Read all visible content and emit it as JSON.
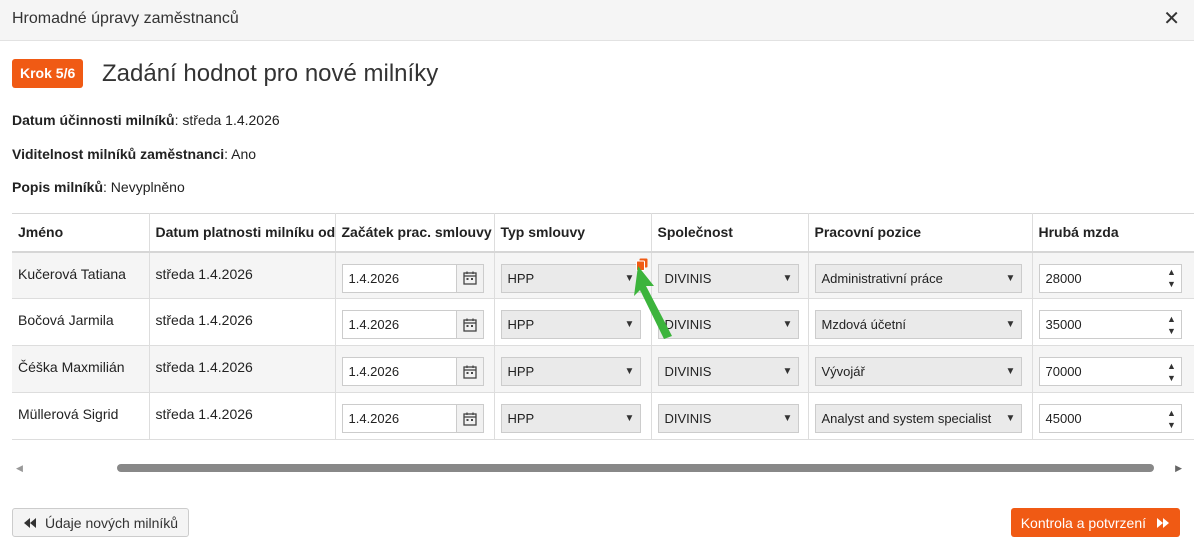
{
  "dialog": {
    "title": "Hromadné úpravy zaměstnanců",
    "close_symbol": "✕"
  },
  "step": {
    "badge": "Krok  5/6",
    "heading": "Zadání hodnot pro nové milníky"
  },
  "info": [
    {
      "label": "Datum účinnosti milníků",
      "value": ": středa 1.4.2026"
    },
    {
      "label": "Viditelnost milníků zaměstnanci",
      "value": ": Ano"
    },
    {
      "label": "Popis milníků",
      "value": ": Nevyplněno"
    }
  ],
  "table": {
    "columns": [
      "Jméno",
      "Datum platnosti milníku od",
      "Začátek prac. smlouvy",
      "Typ smlouvy",
      "Společnost",
      "Pracovní pozice",
      "Hrubá mzda"
    ],
    "rows": [
      {
        "name": "Kučerová Tatiana",
        "valid_from": "středa 1.4.2026",
        "start": "1.4.2026",
        "contract": "HPP",
        "company": "DIVINIS",
        "position": "Administrativní práce",
        "salary": "28000"
      },
      {
        "name": "Bočová Jarmila",
        "valid_from": "středa 1.4.2026",
        "start": "1.4.2026",
        "contract": "HPP",
        "company": "DIVINIS",
        "position": "Mzdová účetní",
        "salary": "35000"
      },
      {
        "name": "Čéška Maxmilián",
        "valid_from": "středa 1.4.2026",
        "start": "1.4.2026",
        "contract": "HPP",
        "company": "DIVINIS",
        "position": "Vývojář",
        "salary": "70000"
      },
      {
        "name": "Müllerová Sigrid",
        "valid_from": "středa 1.4.2026",
        "start": "1.4.2026",
        "contract": "HPP",
        "company": "DIVINIS",
        "position": "Analyst and system specialist",
        "salary": "45000"
      }
    ]
  },
  "buttons": {
    "back_label": "Údaje nových milníků",
    "next_label": "Kontrola a potvrzení"
  },
  "colors": {
    "accent": "#f05a14",
    "arrow": "#3cb43c"
  },
  "icons": {
    "close": "close-icon",
    "calendar": "calendar-icon",
    "copy": "copy-icon",
    "caret": "caret-down-icon",
    "spin": "spinner-icon",
    "back": "double-chevron-left-icon",
    "next": "double-chevron-right-icon"
  }
}
